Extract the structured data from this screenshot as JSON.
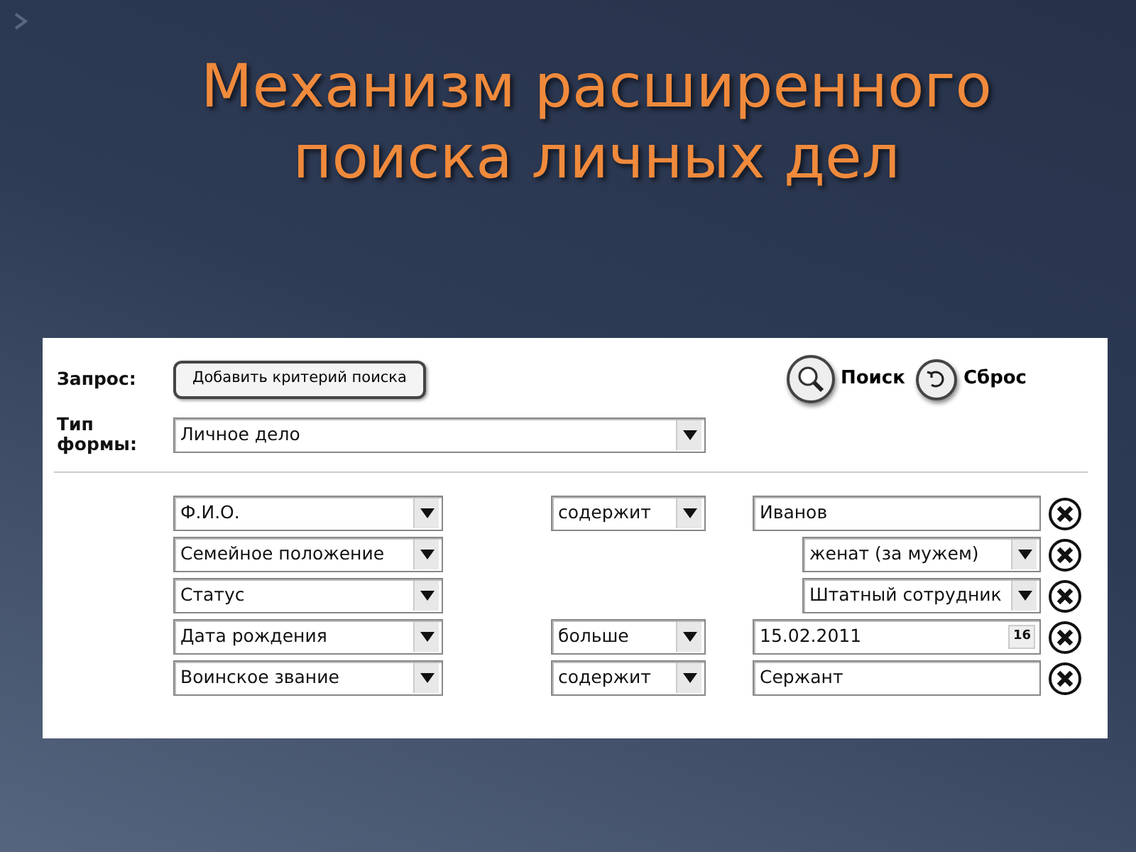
{
  "slide": {
    "title": "Механизм расширенного поиска личных дел"
  },
  "form": {
    "query_label": "Запрос:",
    "add_button": "Добавить критерий поиска",
    "search_button": "Поиск",
    "reset_button": "Сброс",
    "form_type_label": "Тип формы:",
    "form_type": "Личное дело"
  },
  "criteria": [
    {
      "field": "Ф.И.О.",
      "operator": "содержит",
      "kind": "text",
      "value": "Иванов"
    },
    {
      "field": "Семейное положение",
      "kind": "select",
      "value": "женат (за мужем)"
    },
    {
      "field": "Статус",
      "kind": "select",
      "value": "Штатный сотрудник"
    },
    {
      "field": "Дата рождения",
      "operator": "больше",
      "kind": "date",
      "value": "15.02.2011",
      "calendar_label": "16"
    },
    {
      "field": "Воинское звание",
      "operator": "содержит",
      "kind": "text",
      "value": "Сержант"
    }
  ]
}
